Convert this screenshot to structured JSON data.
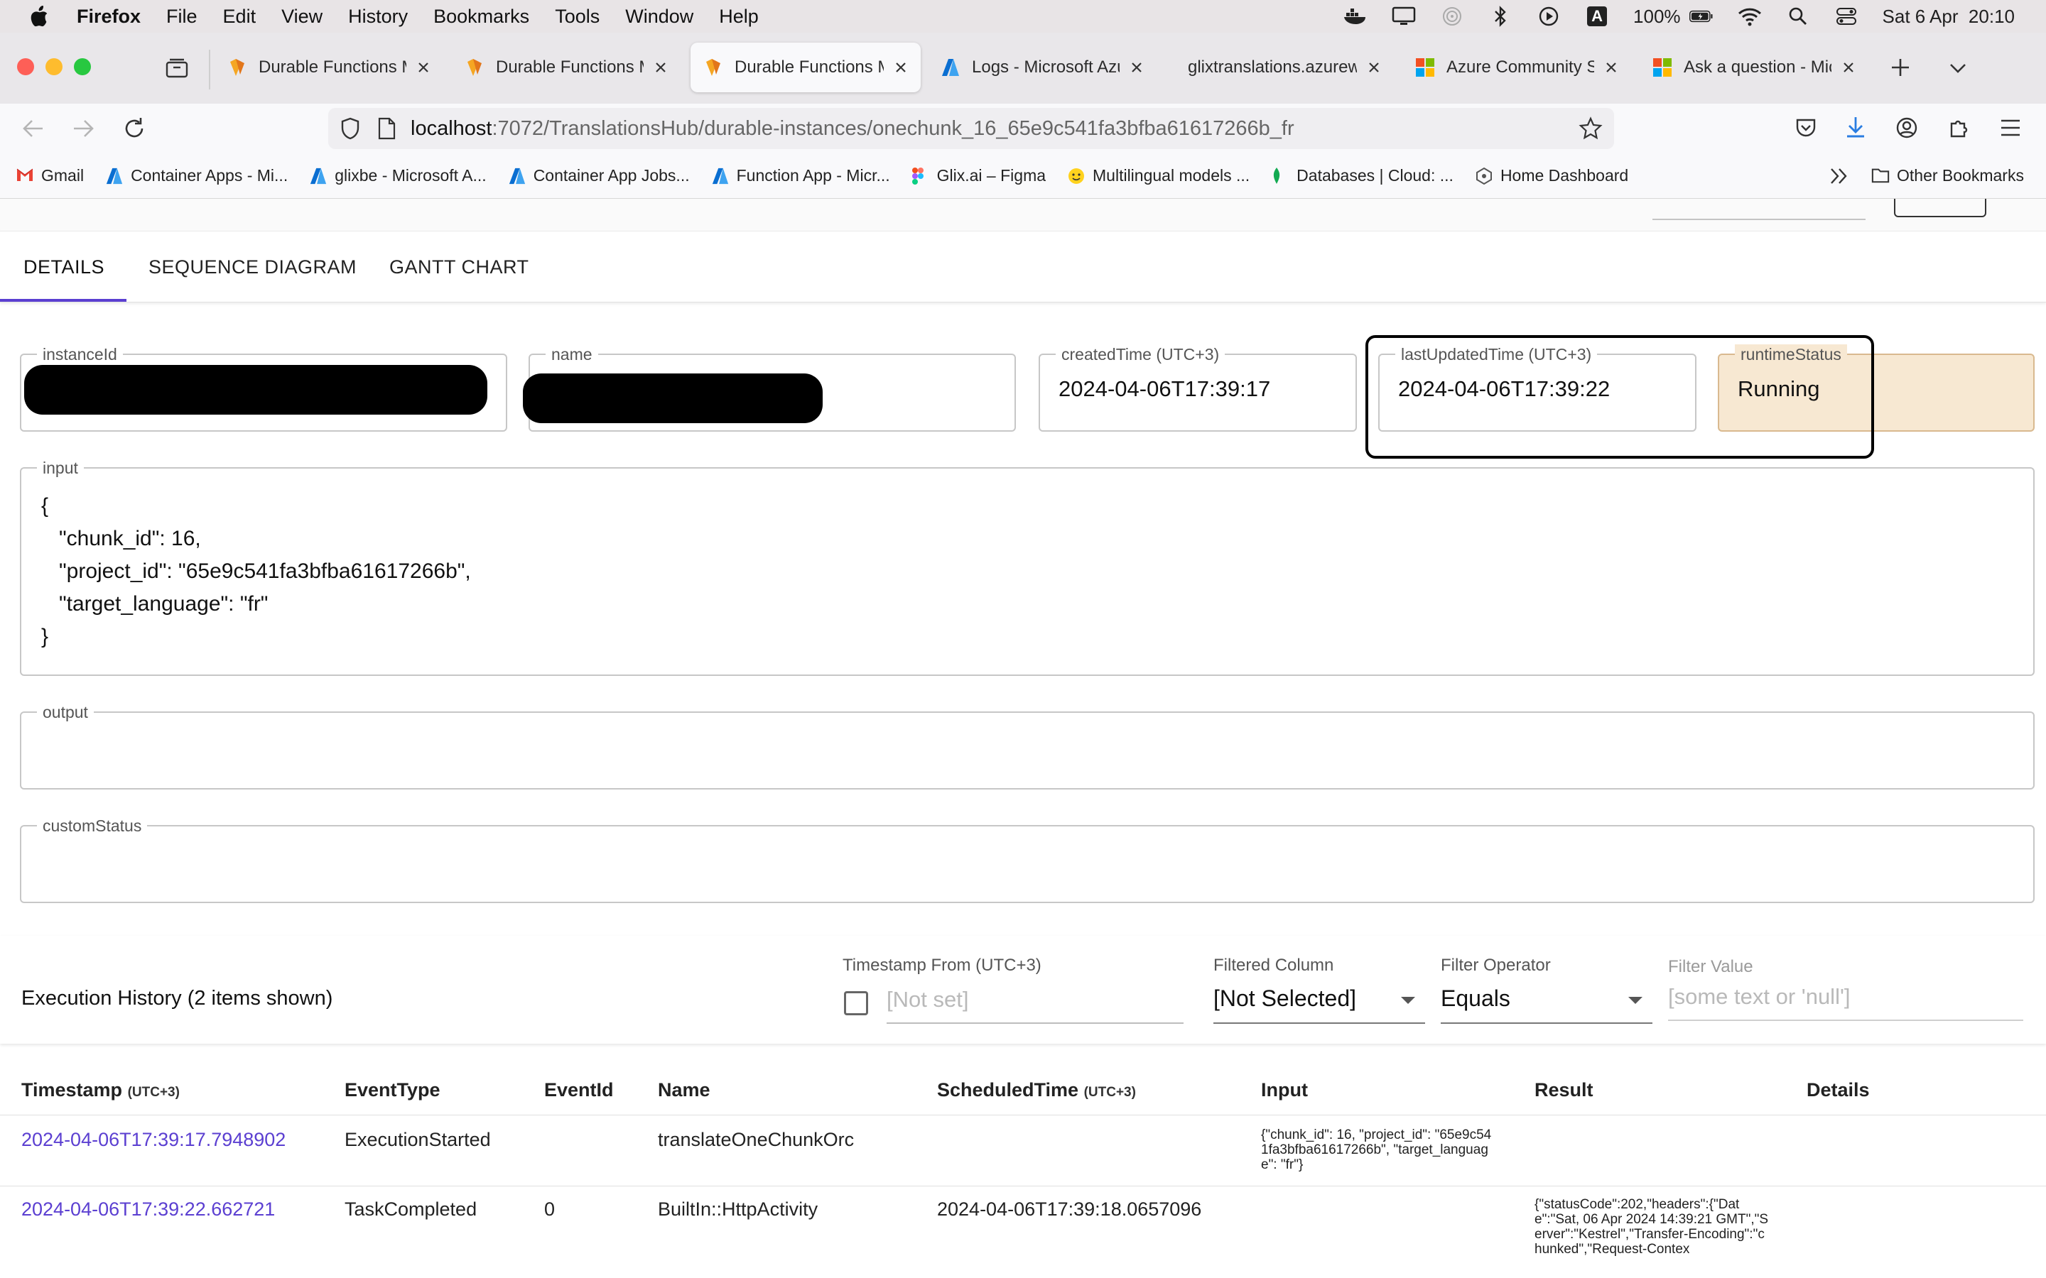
{
  "menubar": {
    "app": "Firefox",
    "items": [
      "File",
      "Edit",
      "View",
      "History",
      "Bookmarks",
      "Tools",
      "Window",
      "Help"
    ],
    "battery": "100%",
    "input_source": "A",
    "datetime": "Sat 6 Apr  20:10"
  },
  "browser_tabs": [
    {
      "label": "Durable Functions M",
      "active": false
    },
    {
      "label": "Durable Functions M",
      "active": false
    },
    {
      "label": "Durable Functions M",
      "active": true
    },
    {
      "label": "Logs - Microsoft Azu",
      "active": false
    },
    {
      "label": "glixtranslations.azurewe",
      "active": false
    },
    {
      "label": "Azure Community Su",
      "active": false
    },
    {
      "label": "Ask a question - Mic",
      "active": false
    }
  ],
  "url": {
    "host": "localhost",
    "path": ":7072/TranslationsHub/durable-instances/onechunk_16_65e9c541fa3bfba61617266b_fr"
  },
  "bookmarks": [
    {
      "label": "Gmail",
      "icon": "gmail-icon"
    },
    {
      "label": "Container Apps - Mi...",
      "icon": "azure-icon"
    },
    {
      "label": "glixbe - Microsoft A...",
      "icon": "azure-icon"
    },
    {
      "label": "Container App Jobs...",
      "icon": "azure-icon"
    },
    {
      "label": "Function App - Micr...",
      "icon": "azure-icon"
    },
    {
      "label": "Glix.ai – Figma",
      "icon": "figma-icon"
    },
    {
      "label": "Multilingual models ...",
      "icon": "huggingface-icon"
    },
    {
      "label": "Databases | Cloud: ...",
      "icon": "mongodb-icon"
    },
    {
      "label": "Home Dashboard",
      "icon": "dashboard-icon"
    }
  ],
  "other_bookmarks": "Other Bookmarks",
  "app_tabs": [
    {
      "label": "DETAILS",
      "active": true
    },
    {
      "label": "SEQUENCE DIAGRAM",
      "active": false
    },
    {
      "label": "GANTT CHART",
      "active": false
    }
  ],
  "fields": {
    "instanceId": {
      "label": "instanceId"
    },
    "name": {
      "label": "name"
    },
    "createdTime": {
      "label": "createdTime (UTC+3)",
      "value": "2024-04-06T17:39:17"
    },
    "lastUpdatedTime": {
      "label": "lastUpdatedTime (UTC+3)",
      "value": "2024-04-06T17:39:22"
    },
    "runtimeStatus": {
      "label": "runtimeStatus",
      "value": "Running"
    },
    "input": {
      "label": "input",
      "value": "{\n   \"chunk_id\": 16,\n   \"project_id\": \"65e9c541fa3bfba61617266b\",\n   \"target_language\": \"fr\"\n}"
    },
    "output": {
      "label": "output",
      "value": ""
    },
    "customStatus": {
      "label": "customStatus",
      "value": ""
    }
  },
  "history": {
    "title": "Execution History (2 items shown)",
    "timestamp_from": {
      "label": "Timestamp From (UTC+3)",
      "placeholder": "[Not set]"
    },
    "filtered_column": {
      "label": "Filtered Column",
      "value": "[Not Selected]"
    },
    "filter_operator": {
      "label": "Filter Operator",
      "value": "Equals"
    },
    "filter_value": {
      "label": "Filter Value",
      "placeholder": "[some text or 'null']"
    },
    "columns": [
      {
        "label": "Timestamp",
        "suffix": "(UTC+3)"
      },
      {
        "label": "EventType",
        "suffix": ""
      },
      {
        "label": "EventId",
        "suffix": ""
      },
      {
        "label": "Name",
        "suffix": ""
      },
      {
        "label": "ScheduledTime",
        "suffix": "(UTC+3)"
      },
      {
        "label": "Input",
        "suffix": ""
      },
      {
        "label": "Result",
        "suffix": ""
      },
      {
        "label": "Details",
        "suffix": ""
      }
    ],
    "rows": [
      {
        "timestamp": "2024-04-06T17:39:17.7948902",
        "eventType": "ExecutionStarted",
        "eventId": "",
        "name": "translateOneChunkOrc",
        "scheduledTime": "",
        "input": "{\"chunk_id\": 16, \"project_id\": \"65e9c541fa3bfba61617266b\", \"target_language\": \"fr\"}",
        "result": ""
      },
      {
        "timestamp": "2024-04-06T17:39:22.662721",
        "eventType": "TaskCompleted",
        "eventId": "0",
        "name": "BuiltIn::HttpActivity",
        "scheduledTime": "2024-04-06T17:39:18.0657096",
        "input": "",
        "result": "{\"statusCode\":202,\"headers\":{\"Date\":\"Sat, 06 Apr 2024 14:39:21 GMT\",\"Server\":\"Kestrel\",\"Transfer-Encoding\":\"chunked\",\"Request-Contex"
      }
    ]
  },
  "colors": {
    "accent": "#5b3fd1",
    "running_bg": "#f7e8d2",
    "running_border": "#d9b98f"
  }
}
